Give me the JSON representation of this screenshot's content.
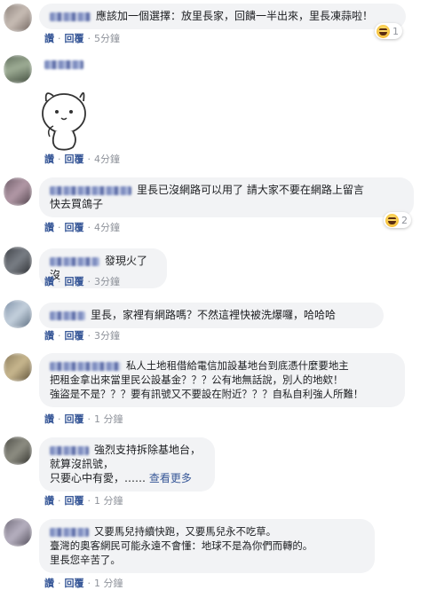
{
  "actions": {
    "read": "讚",
    "reply": "回覆"
  },
  "comments": [
    {
      "text": "應該加一個選擇：放里長家，回饋一半出來，里長凍蒜啦！",
      "time": "5分鐘",
      "reaction": {
        "icon": "haha-icon",
        "count": "1"
      }
    },
    {
      "text": "",
      "time": "4分鐘",
      "sticker": "white-cat-sticker"
    },
    {
      "text": "里長已沒網路可以用了 請大家不要在網路上留言\n快去買鴿子",
      "time": "4分鐘",
      "reaction": {
        "icon": "haha-icon",
        "count": "2"
      }
    },
    {
      "text": "發現火了沒",
      "time": "3分鐘"
    },
    {
      "text": "里長，家裡有網路嗎？不然這裡快被洗爆囉，哈哈哈",
      "time": "3分鐘"
    },
    {
      "text": "私人土地租借給電信加設基地台到底憑什麼要地主\n把租金拿出來當里民公設基金？？？公有地無話說，別人的地欸！\n強盜是不是？？？要有訊號又不要設在附近？？？自私自利強人所難！",
      "time": "1 分鐘"
    },
    {
      "text": "強烈支持拆除基地台，\n就算沒訊號，\n只要心中有愛，……",
      "more": "查看更多",
      "time": "1 分鐘"
    },
    {
      "text": "又要馬兒持續快跑，又要馬兒永不吃草。\n臺灣的奧客網民可能永遠不會懂：地球不是為你們而轉的。\n里長您辛苦了。",
      "time": "1 分鐘"
    }
  ],
  "colors": {
    "bubble": "#f2f3f5",
    "link": "#385898",
    "muted": "#90949c",
    "text": "#1c1e21"
  }
}
